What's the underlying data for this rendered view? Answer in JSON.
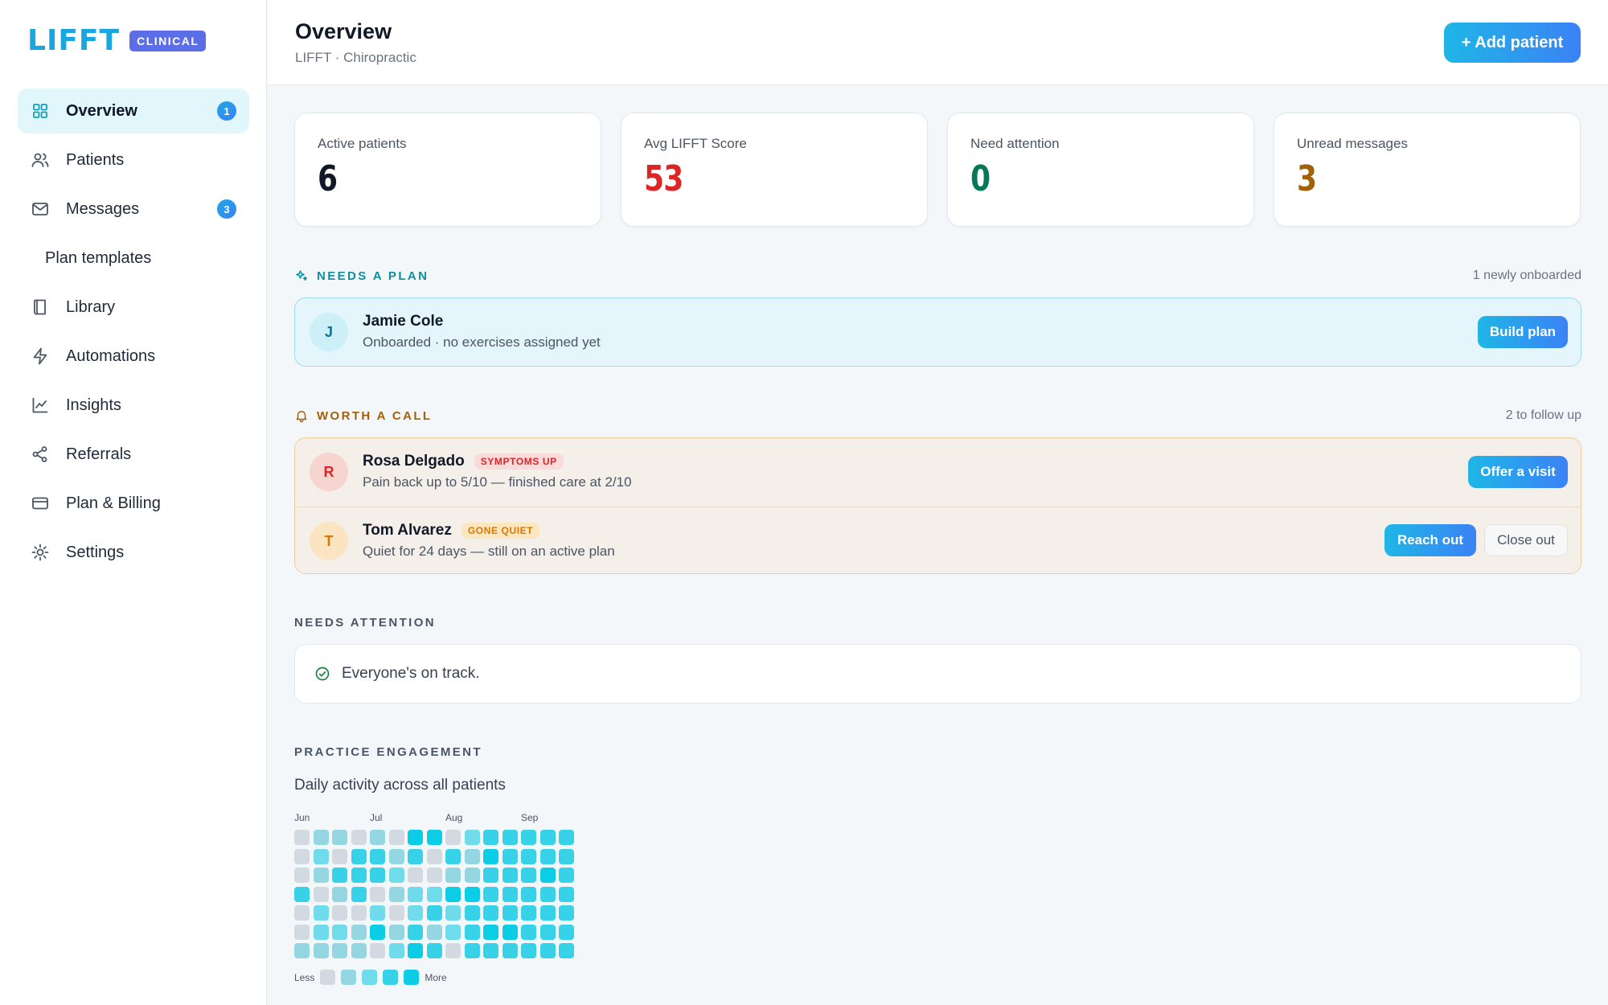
{
  "sidebar": {
    "logo": "LIFFT",
    "badge": "CLINICAL",
    "items": [
      {
        "label": "Overview",
        "icon": "grid-icon",
        "active": true,
        "badge": "1"
      },
      {
        "label": "Patients",
        "icon": "users-icon"
      },
      {
        "label": "Messages",
        "icon": "mail-icon",
        "badge": "3"
      },
      {
        "label": "Plan templates"
      },
      {
        "label": "Library",
        "icon": "book-icon"
      },
      {
        "label": "Automations",
        "icon": "bolt-icon"
      },
      {
        "label": "Insights",
        "icon": "chart-icon"
      },
      {
        "label": "Referrals",
        "icon": "share-icon"
      },
      {
        "label": "Plan & Billing",
        "icon": "card-icon"
      },
      {
        "label": "Settings",
        "icon": "gear-icon"
      }
    ]
  },
  "header": {
    "title": "Overview",
    "subtitle": "LIFFT · Chiropractic",
    "add_label": "+ Add patient"
  },
  "stats": [
    {
      "label": "Active patients",
      "value": "6",
      "color": "#111827"
    },
    {
      "label": "Avg LIFFT Score",
      "value": "53",
      "color": "#dc2626"
    },
    {
      "label": "Need attention",
      "value": "0",
      "color": "#047857"
    },
    {
      "label": "Unread messages",
      "value": "3",
      "color": "#a16207"
    }
  ],
  "needs_plan": {
    "title": "NEEDS A PLAN",
    "meta": "1 newly onboarded",
    "patient": {
      "initial": "J",
      "name": "Jamie Cole",
      "desc": "Onboarded · no exercises assigned yet",
      "action": "Build plan"
    }
  },
  "worth_call": {
    "title": "WORTH A CALL",
    "meta": "2 to follow up",
    "rows": [
      {
        "initial": "R",
        "name": "Rosa Delgado",
        "tag": "SYMPTOMS UP",
        "desc": "Pain back up to 5/10 — finished care at 2/10",
        "action": "Offer a visit"
      },
      {
        "initial": "T",
        "name": "Tom Alvarez",
        "tag": "GONE QUIET",
        "desc": "Quiet for 24 days — still on an active plan",
        "action": "Reach out",
        "secondary": "Close out"
      }
    ]
  },
  "needs_attention": {
    "title": "NEEDS ATTENTION",
    "message": "Everyone's on track."
  },
  "engagement": {
    "title": "PRACTICE ENGAGEMENT",
    "subtitle": "Daily activity across all patients",
    "months": [
      "Jun",
      "Jul",
      "Aug",
      "Sep"
    ],
    "legend_less": "Less",
    "legend_more": "More",
    "levels_colors": [
      "#d3d9e0",
      "#94d6e2",
      "#6fdbeb",
      "#38d2e8",
      "#0ccde6"
    ],
    "grid": [
      [
        0,
        1,
        1,
        0,
        1,
        0,
        4,
        4,
        0,
        2,
        3,
        3,
        3,
        3,
        3
      ],
      [
        0,
        2,
        0,
        3,
        3,
        1,
        3,
        0,
        3,
        1,
        4,
        3,
        3,
        3,
        3
      ],
      [
        0,
        1,
        3,
        3,
        3,
        2,
        0,
        0,
        1,
        1,
        3,
        3,
        3,
        4,
        3
      ],
      [
        3,
        0,
        1,
        3,
        0,
        1,
        2,
        2,
        4,
        4,
        3,
        3,
        3,
        3,
        3
      ],
      [
        0,
        2,
        0,
        0,
        2,
        0,
        2,
        3,
        2,
        3,
        3,
        3,
        3,
        3,
        3
      ],
      [
        0,
        2,
        2,
        1,
        4,
        1,
        3,
        1,
        2,
        3,
        4,
        4,
        3,
        3,
        3
      ],
      [
        1,
        1,
        1,
        1,
        0,
        2,
        4,
        3,
        0,
        3,
        3,
        3,
        3,
        3,
        3
      ]
    ]
  }
}
